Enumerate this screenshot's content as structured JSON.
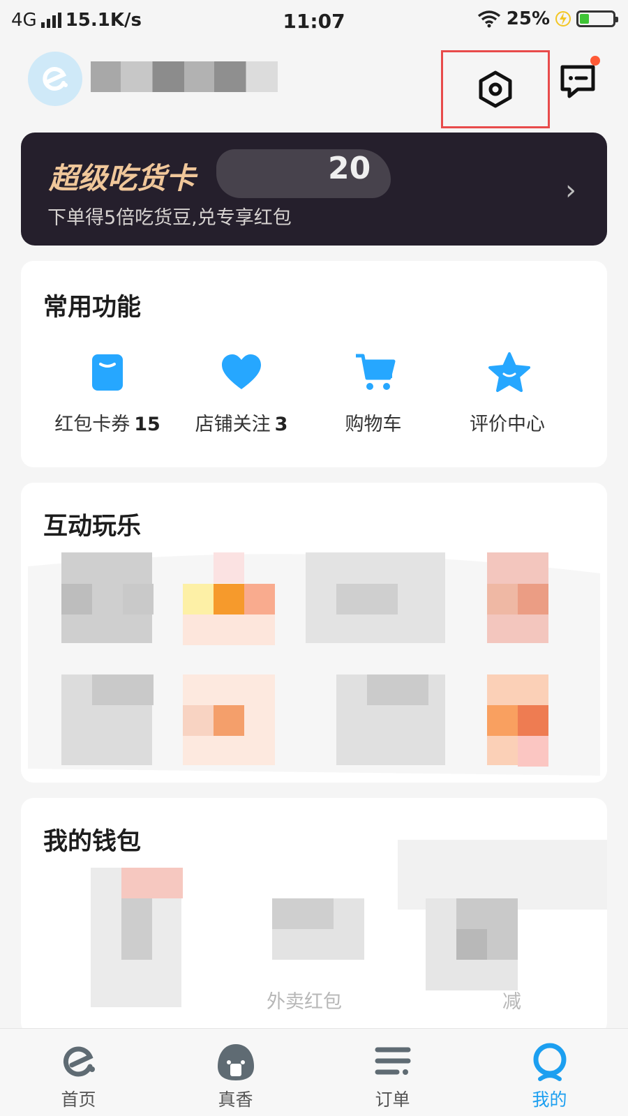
{
  "status_bar": {
    "network": "4G",
    "speed": "15.1K/s",
    "time": "11:07",
    "battery": "25%"
  },
  "header": {
    "settings_icon": "settings-icon",
    "message_icon": "message-icon"
  },
  "vip_card": {
    "title": "超级吃货卡",
    "number": "20",
    "subtitle": "下单得5倍吃货豆,兑专享红包",
    "chevron": "›"
  },
  "common_functions": {
    "title": "常用功能",
    "items": [
      {
        "label": "红包卡券",
        "count": "15",
        "icon": "coupon-icon"
      },
      {
        "label": "店铺关注",
        "count": "3",
        "icon": "heart-icon"
      },
      {
        "label": "购物车",
        "count": "",
        "icon": "cart-icon"
      },
      {
        "label": "评价中心",
        "count": "",
        "icon": "star-icon"
      }
    ]
  },
  "interactive_fun": {
    "title": "互动玩乐"
  },
  "wallet": {
    "title": "我的钱包",
    "items": [
      {
        "label": "外卖红包"
      },
      {
        "label": "减"
      }
    ]
  },
  "bottom_nav": {
    "items": [
      {
        "label": "首页",
        "icon": "home-icon"
      },
      {
        "label": "真香",
        "icon": "discover-icon"
      },
      {
        "label": "订单",
        "icon": "orders-icon"
      },
      {
        "label": "我的",
        "icon": "profile-icon"
      }
    ],
    "active_index": 3
  },
  "colors": {
    "accent": "#1c9ff0",
    "vip_gold": "#f0c79a",
    "highlight_box": "#e84b4b"
  }
}
